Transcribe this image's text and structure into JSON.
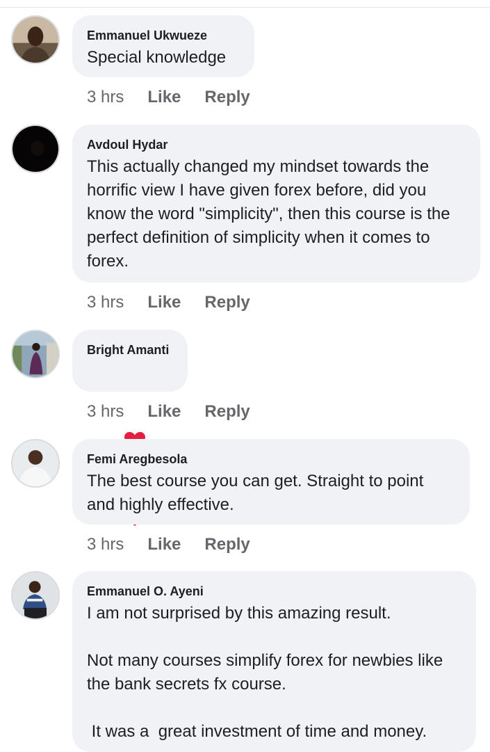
{
  "comments": [
    {
      "author": "Emmanuel Ukwueze",
      "text": "Special knowledge",
      "time": "3 hrs",
      "like_label": "Like",
      "reply_label": "Reply"
    },
    {
      "author": "Avdoul Hydar",
      "text": "This actually changed my mindset towards the horrific view I have given forex before, did you know the word \"simplicity\", then this course is the perfect definition of simplicity when it comes to forex.",
      "time": "3 hrs",
      "like_label": "Like",
      "reply_label": "Reply"
    },
    {
      "author": "Bright Amanti",
      "text": "",
      "reaction_icons": [
        "heart-icon",
        "heart-icon"
      ],
      "time": "3 hrs",
      "like_label": "Like",
      "reply_label": "Reply"
    },
    {
      "author": "Femi Aregbesola",
      "text": "The best course you can get. Straight to point and highly effective.",
      "time": "3 hrs",
      "like_label": "Like",
      "reply_label": "Reply"
    },
    {
      "author": "Emmanuel O. Ayeni",
      "text": "I am not surprised by this amazing result.\n\nNot many courses simplify forex for newbies like the bank secrets fx course.\n\n It was a  great investment of time and money."
    }
  ],
  "colors": {
    "bubble_bg": "#f0f2f5",
    "action_text": "#65676b",
    "heart": "#e41e3f"
  }
}
